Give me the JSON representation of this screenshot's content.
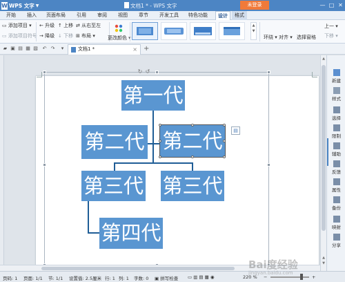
{
  "app": {
    "name": "WPS 文字",
    "window_title": "文档1 * - WPS 文字",
    "login_label": "未登录",
    "window_controls": [
      "—",
      "□",
      "✕"
    ]
  },
  "menu_tabs": [
    "开始",
    "插入",
    "页面布局",
    "引用",
    "审阅",
    "视图",
    "章节",
    "开发工具",
    "特色功能",
    "设计",
    "格式"
  ],
  "active_tab": "设计",
  "ribbon": {
    "add_item": "添加项目",
    "add_item_bullet": "添加项目符号",
    "promote": "升级",
    "demote": "降级",
    "move_up": "上移",
    "move_down": "下移",
    "right_to_left": "从右至左",
    "layout": "布局",
    "change_color": "更改颜色",
    "wrap": "环绕",
    "align": "对齐",
    "selection_pane": "选择窗格",
    "bring_forward": "上一",
    "send_backward": "下移"
  },
  "document_tab": {
    "name": "文档1 *"
  },
  "smartart": {
    "gen1": "第一代",
    "gen2_left": "第二代",
    "gen2_right": "第二代",
    "gen3_left": "第三代",
    "gen3_right": "第三代",
    "gen4": "第四代",
    "node_color": "#5a96d1",
    "connector_color": "#1f5d96"
  },
  "task_pane": [
    "新建",
    "样式",
    "选择",
    "限制",
    "备份",
    "属性",
    "备份",
    "映射",
    "分享"
  ],
  "task_pane_visible": [
    "新建",
    "样式",
    "选择",
    "限制",
    "辅助",
    "反馈",
    "属性",
    "备份",
    "映射",
    "分享"
  ],
  "status": {
    "page": "页码: 1",
    "pages": "页面: 1/1",
    "section": "节: 1/1",
    "setting": "设置值: 2.5厘米",
    "row": "行: 1",
    "column": "列: 1",
    "words": "字数: 0",
    "spell": "拼写检查",
    "zoom": "220 %"
  },
  "watermark": {
    "brand": "Bai度经验",
    "url": "jingyan.baidu.com"
  }
}
